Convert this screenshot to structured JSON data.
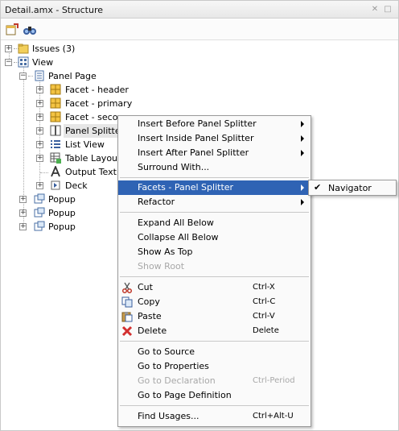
{
  "window": {
    "title": "Detail.amx - Structure"
  },
  "tree": {
    "issues": "Issues (3)",
    "view": "View",
    "panel_page": "Panel Page",
    "children": [
      "Facet - header",
      "Facet - primary",
      "Facet - second",
      "Panel Splitter",
      "List View",
      "Table Layout",
      "Output Text -",
      "Deck"
    ],
    "popups": [
      "Popup",
      "Popup",
      "Popup"
    ]
  },
  "menu": {
    "insert_before": "Insert Before Panel Splitter",
    "insert_inside": "Insert Inside Panel Splitter",
    "insert_after": "Insert After Panel Splitter",
    "surround_with": "Surround With...",
    "facets": "Facets - Panel Splitter",
    "refactor": "Refactor",
    "expand_all": "Expand All Below",
    "collapse_all": "Collapse All Below",
    "show_as_top": "Show As Top",
    "show_root": "Show Root",
    "cut": "Cut",
    "cut_shortcut": "Ctrl-X",
    "copy": "Copy",
    "copy_shortcut": "Ctrl-C",
    "paste": "Paste",
    "paste_shortcut": "Ctrl-V",
    "delete": "Delete",
    "delete_shortcut": "Delete",
    "go_to_source": "Go to Source",
    "go_to_properties": "Go to Properties",
    "go_to_declaration": "Go to Declaration",
    "go_to_declaration_shortcut": "Ctrl-Period",
    "go_to_page_definition": "Go to Page Definition",
    "find_usages": "Find Usages...",
    "find_usages_shortcut": "Ctrl+Alt-U"
  },
  "submenu": {
    "check": "✔",
    "navigator": "Navigator"
  },
  "colors": {
    "highlight": "#2f63b4",
    "disabled_text": "#a8a8a8"
  }
}
